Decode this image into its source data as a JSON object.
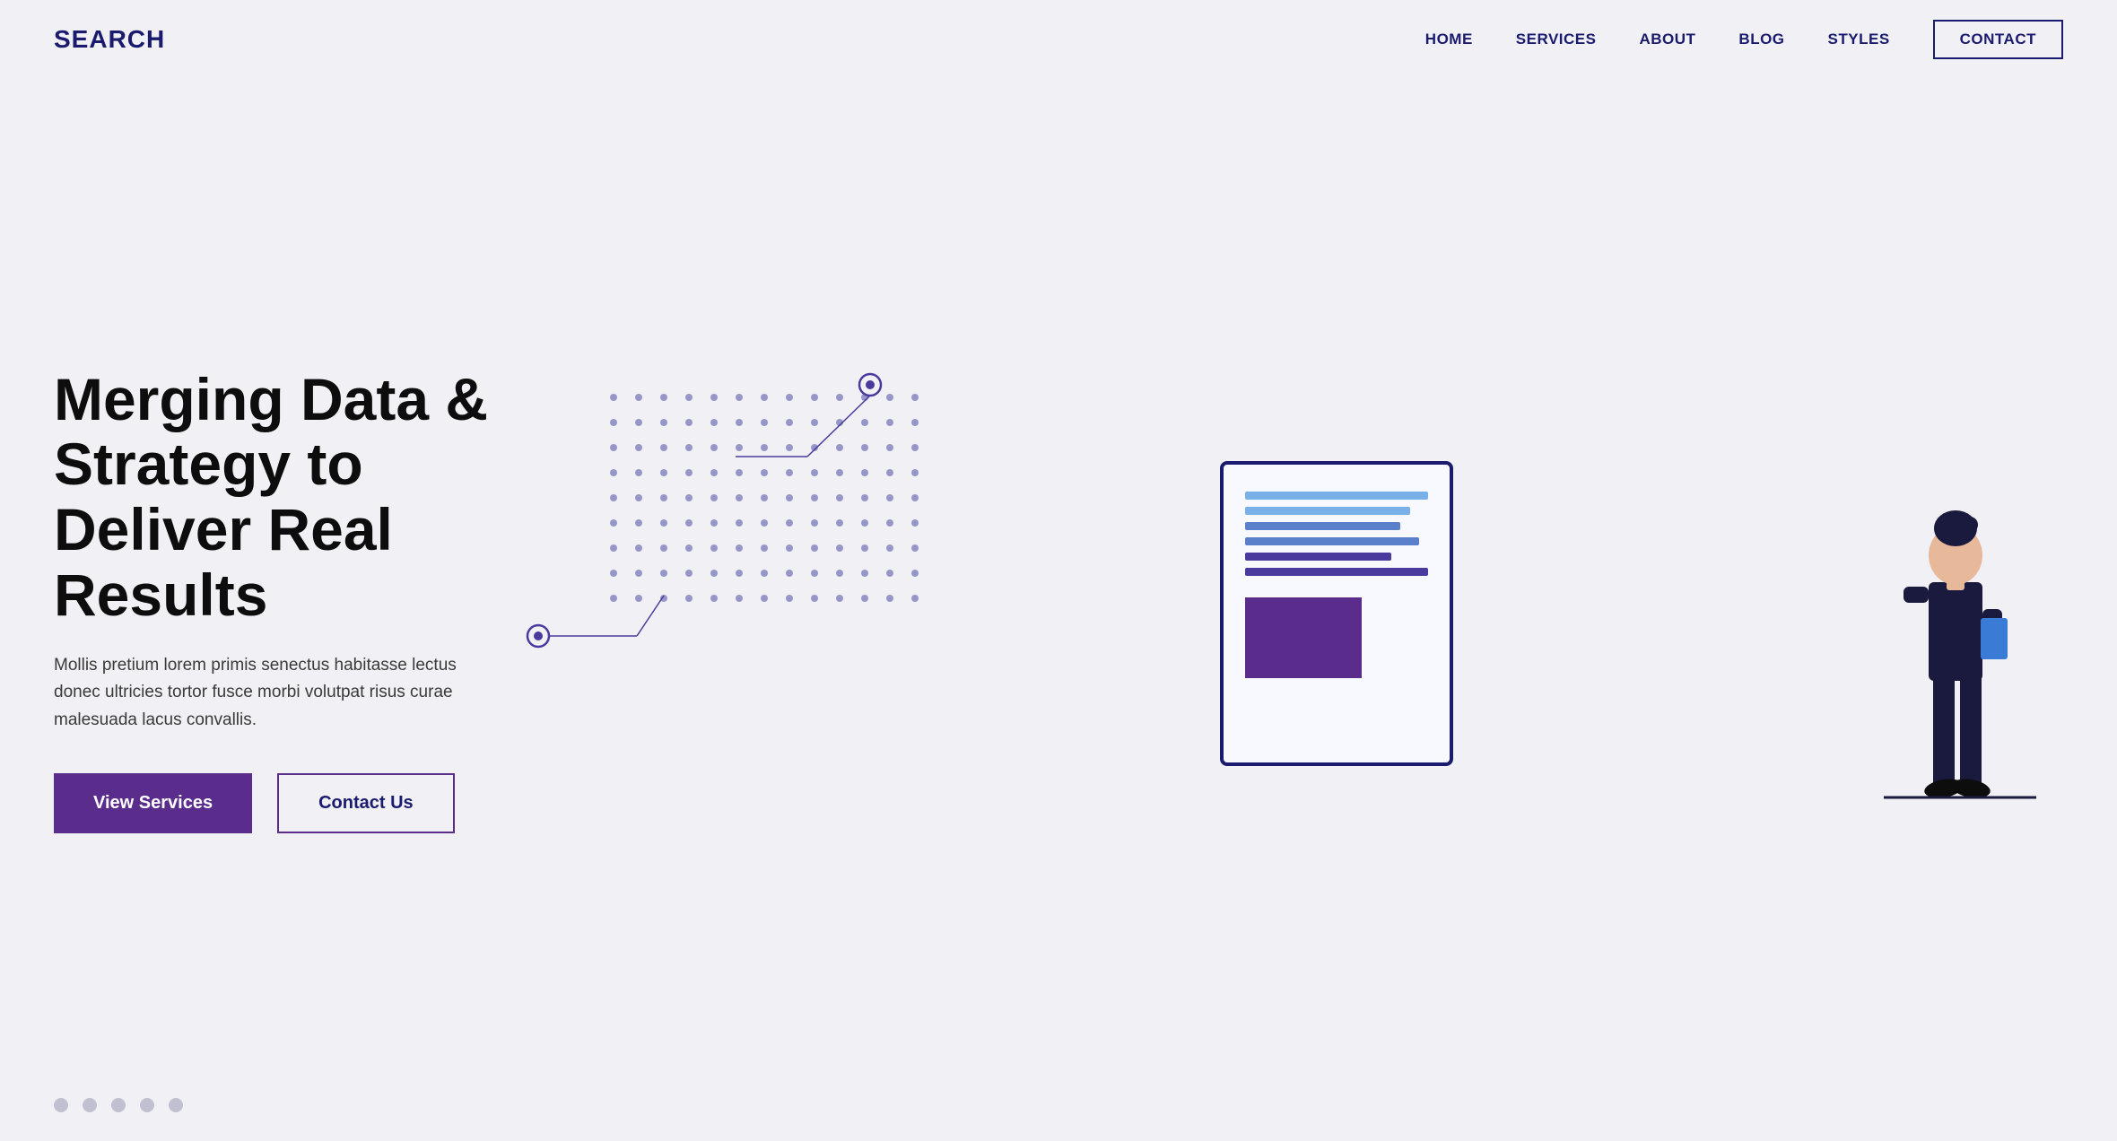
{
  "nav": {
    "logo": "SEARCH",
    "links": [
      {
        "label": "HOME",
        "id": "home"
      },
      {
        "label": "SERVICES",
        "id": "services"
      },
      {
        "label": "ABOUT",
        "id": "about"
      },
      {
        "label": "BLOG",
        "id": "blog"
      },
      {
        "label": "STYLES",
        "id": "styles"
      }
    ],
    "contact_button": "CONTACT"
  },
  "hero": {
    "title": "Merging Data & Strategy to Deliver Real Results",
    "description": "Mollis pretium lorem primis senectus habitasse lectus donec ultricies tortor fusce morbi volutpat risus curae malesuada lacus convallis.",
    "btn_primary": "View Services",
    "btn_outline": "Contact Us"
  },
  "colors": {
    "primary": "#5a2d8c",
    "navy": "#1a1a6e",
    "bg": "#f0f0f5"
  }
}
